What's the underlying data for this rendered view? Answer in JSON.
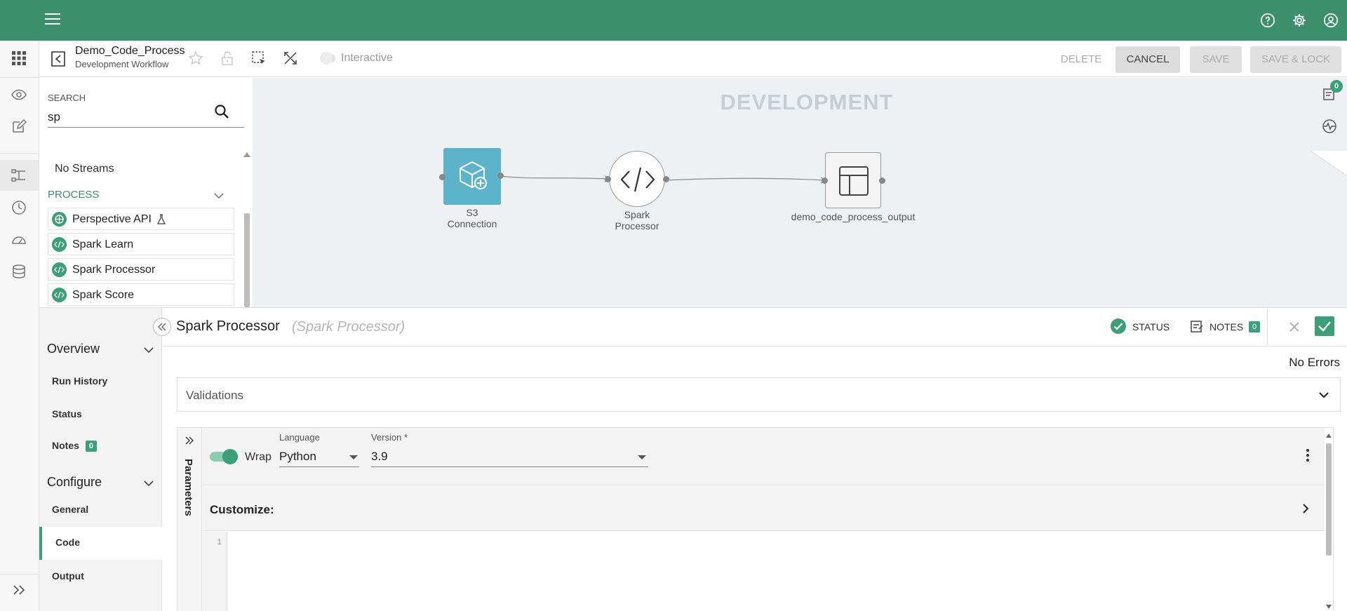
{
  "header": {
    "help": "help-icon",
    "settings": "gear-icon",
    "account": "account-icon"
  },
  "toolbar": {
    "title": "Demo_Code_Process",
    "subtitle": "Development Workflow",
    "interactive_label": "Interactive",
    "delete_label": "DELETE",
    "cancel_label": "CANCEL",
    "save_label": "SAVE",
    "save_lock_label": "SAVE & LOCK"
  },
  "search": {
    "label": "SEARCH",
    "value": "sp",
    "no_streams": "No Streams",
    "process_heading": "PROCESS",
    "items": [
      {
        "label": "Perspective API"
      },
      {
        "label": "Spark Learn"
      },
      {
        "label": "Spark Processor"
      },
      {
        "label": "Spark Score"
      }
    ]
  },
  "canvas": {
    "environment": "DEVELOPMENT",
    "nodes": [
      {
        "label": "S3\nConnection"
      },
      {
        "label": "Spark\nProcessor"
      },
      {
        "label": "demo_code_process_output"
      }
    ],
    "notifications_count": "0"
  },
  "nav": {
    "overview": "Overview",
    "run_history": "Run History",
    "status": "Status",
    "notes": "Notes",
    "notes_count": "0",
    "configure": "Configure",
    "general": "General",
    "code": "Code",
    "output": "Output"
  },
  "panel": {
    "title": "Spark Processor",
    "subtitle": "(Spark Processor)",
    "status_label": "STATUS",
    "notes_label": "NOTES",
    "notes_count": "0",
    "no_errors": "No Errors",
    "validations": "Validations"
  },
  "editor": {
    "parameters_label": "Parameters",
    "wrap_label": "Wrap",
    "language_label": "Language",
    "language_value": "Python",
    "version_label": "Version *",
    "version_value": "3.9",
    "customize_label": "Customize:",
    "line_number": "1"
  },
  "colors": {
    "brand_green": "#3b8f6d",
    "accent_green": "#3b9f78",
    "node_blue": "#5bb4c9"
  }
}
